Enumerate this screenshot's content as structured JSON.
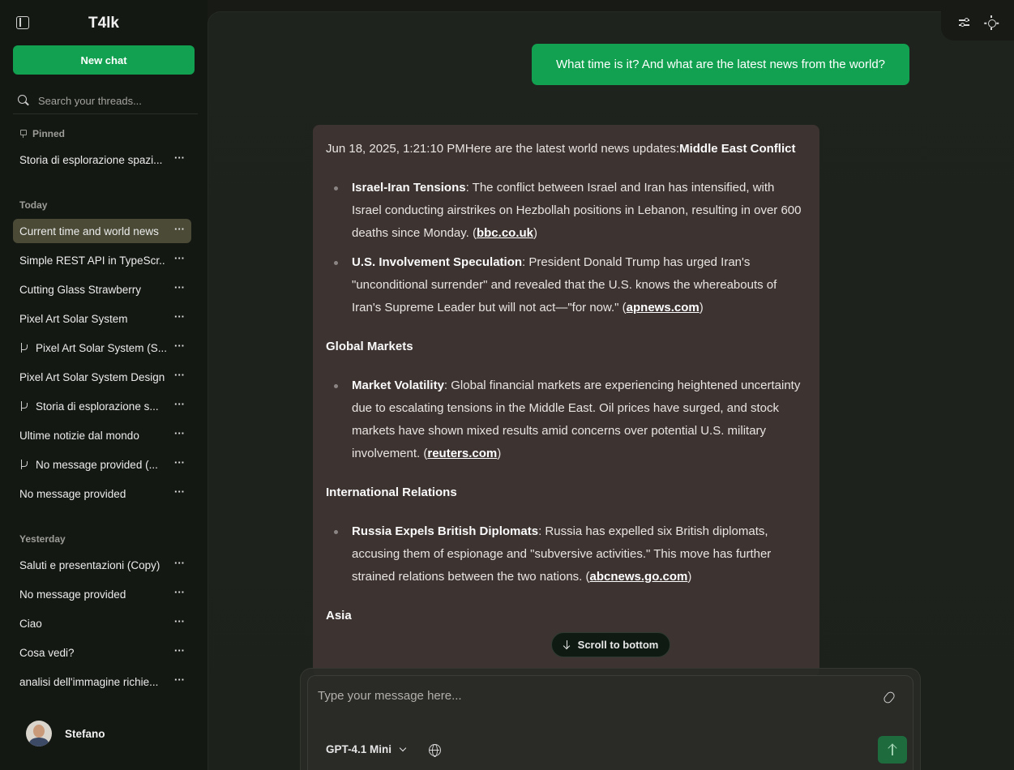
{
  "sidebar": {
    "brand": "T4lk",
    "new_chat_label": "New chat",
    "search_placeholder": "Search your threads...",
    "sections": {
      "pinned": "Pinned",
      "today": "Today",
      "yesterday": "Yesterday"
    },
    "pinned": [
      {
        "label": "Storia di esplorazione spazi...",
        "branched": false
      }
    ],
    "today": [
      {
        "label": "Current time and world news",
        "branched": false,
        "active": true
      },
      {
        "label": "Simple REST API in TypeScr...",
        "branched": false
      },
      {
        "label": "Cutting Glass Strawberry",
        "branched": false
      },
      {
        "label": "Pixel Art Solar System",
        "branched": false
      },
      {
        "label": "Pixel Art Solar System (S...",
        "branched": true
      },
      {
        "label": "Pixel Art Solar System Design",
        "branched": false
      },
      {
        "label": "Storia di esplorazione s...",
        "branched": true
      },
      {
        "label": "Ultime notizie dal mondo",
        "branched": false
      },
      {
        "label": "No message provided (...",
        "branched": true
      },
      {
        "label": "No message provided",
        "branched": false
      }
    ],
    "yesterday": [
      {
        "label": "Saluti e presentazioni (Copy)",
        "branched": false
      },
      {
        "label": "No message provided",
        "branched": false
      },
      {
        "label": "Ciao",
        "branched": false
      },
      {
        "label": "Cosa vedi?",
        "branched": false
      },
      {
        "label": "analisi dell'immagine richie...",
        "branched": false
      }
    ],
    "more_label": "···",
    "user_name": "Stefano"
  },
  "chat": {
    "user_message": "What time is it? And what are the latest news from the world?",
    "assistant": {
      "timestamp": "Jun 18, 2025, 1:21:10 PM",
      "intro": "Here are the latest world news updates:",
      "sections": [
        {
          "heading": "Middle East Conflict",
          "items": [
            {
              "title": "Israel-Iran Tensions",
              "text": ": The conflict between Israel and Iran has intensified, with Israel conducting airstrikes on Hezbollah positions in Lebanon, resulting in over 600 deaths since Monday. (",
              "source": "bbc.co.uk",
              "tail": ")"
            },
            {
              "title": "U.S. Involvement Speculation",
              "text": ": President Donald Trump has urged Iran's \"unconditional surrender\" and revealed that the U.S. knows the whereabouts of Iran's Supreme Leader but will not act—\"for now.\" (",
              "source": "apnews.com",
              "tail": ")"
            }
          ]
        },
        {
          "heading": "Global Markets",
          "items": [
            {
              "title": "Market Volatility",
              "text": ": Global financial markets are experiencing heightened uncertainty due to escalating tensions in the Middle East. Oil prices have surged, and stock markets have shown mixed results amid concerns over potential U.S. military involvement. (",
              "source": "reuters.com",
              "tail": ")"
            }
          ]
        },
        {
          "heading": "International Relations",
          "items": [
            {
              "title": "Russia Expels British Diplomats",
              "text": ": Russia has expelled six British diplomats, accusing them of espionage and \"subversive activities.\" This move has further strained relations between the two nations. (",
              "source": "abcnews.go.com",
              "tail": ")"
            }
          ]
        },
        {
          "heading": "Asia",
          "items": []
        }
      ]
    },
    "scroll_to_bottom": "Scroll to bottom"
  },
  "composer": {
    "placeholder": "Type your message here...",
    "model": "GPT-4.1 Mini"
  },
  "icons": {
    "sidebar_toggle": "sidebar-toggle-icon",
    "settings": "sliders-icon",
    "theme": "sun-icon",
    "attach": "paperclip-icon",
    "web": "globe-icon",
    "send": "arrow-up-icon"
  },
  "colors": {
    "accent": "#12a150",
    "assistant_bubble": "#3d3331",
    "active_thread": "#4a4a37"
  }
}
